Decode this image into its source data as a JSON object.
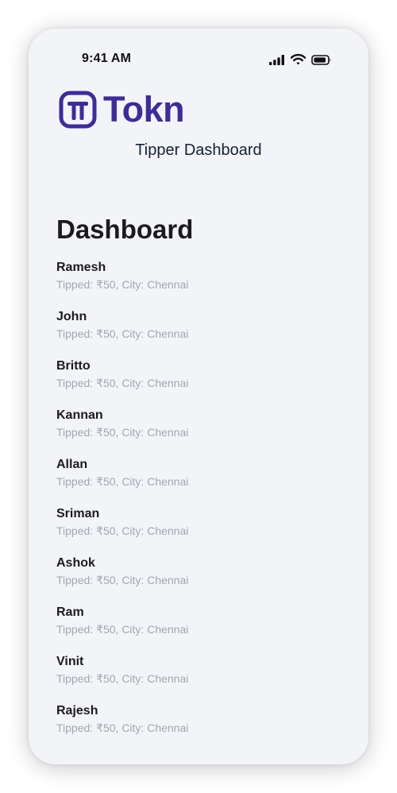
{
  "status_bar": {
    "time": "9:41 AM",
    "icons": [
      "cellular-signal-icon",
      "wifi-icon",
      "battery-icon"
    ]
  },
  "brand": {
    "name": "Tokn",
    "color": "#3f2a9e"
  },
  "header": {
    "subtitle": "Tipper Dashboard"
  },
  "main": {
    "title": "Dashboard",
    "tippers": [
      {
        "name": "Ramesh",
        "detail": "Tipped: ₹50, City: Chennai"
      },
      {
        "name": "John",
        "detail": "Tipped: ₹50, City: Chennai"
      },
      {
        "name": "Britto",
        "detail": "Tipped: ₹50, City: Chennai"
      },
      {
        "name": "Kannan",
        "detail": "Tipped: ₹50, City: Chennai"
      },
      {
        "name": "Allan",
        "detail": "Tipped: ₹50, City: Chennai"
      },
      {
        "name": "Sriman",
        "detail": "Tipped: ₹50, City: Chennai"
      },
      {
        "name": "Ashok",
        "detail": "Tipped: ₹50, City: Chennai"
      },
      {
        "name": "Ram",
        "detail": "Tipped: ₹50, City: Chennai"
      },
      {
        "name": "Vinit",
        "detail": "Tipped: ₹50, City: Chennai"
      },
      {
        "name": "Rajesh",
        "detail": "Tipped: ₹50, City: Chennai"
      }
    ]
  }
}
